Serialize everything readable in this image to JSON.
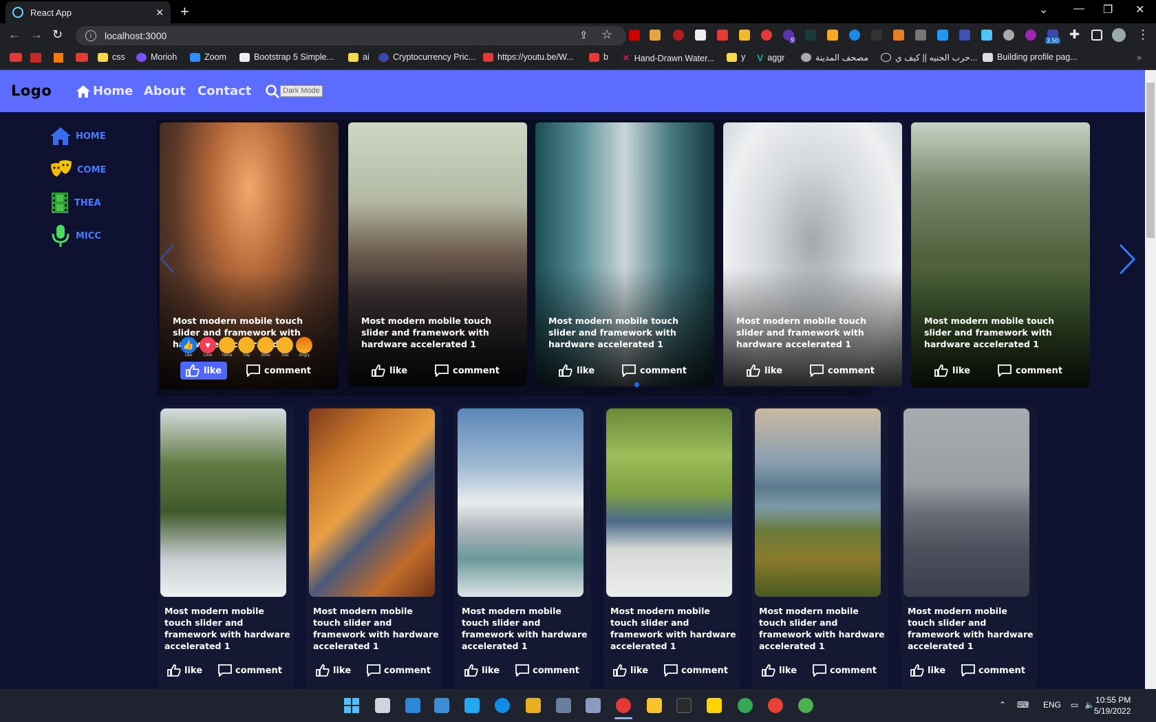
{
  "browser": {
    "tab_title": "React App",
    "new_tab": "+",
    "url": "localhost:3000",
    "bookmarks": [
      "css",
      "Morioh",
      "Zoom",
      "Bootstrap 5 Simple...",
      "ai",
      "Cryptocurrency Pric...",
      "https://youtu.be/W...",
      "b",
      "Hand-Drawn Water...",
      "y",
      "aggr",
      "مصحف المدينة",
      "حرب الجنيه || كيف ي...",
      "Building profile pag..."
    ],
    "ext_badges": [
      "9",
      "3.50"
    ]
  },
  "app": {
    "logo": "Logo",
    "nav": [
      "Home",
      "About",
      "Contact"
    ],
    "dark_mode": "Dark Mode",
    "sidebar": [
      "HOME",
      "COME",
      "THEA",
      "MICC"
    ],
    "slider": {
      "cards": [
        {
          "title": "Most modern mobile touch slider and framework with hardware accelerated 1",
          "like": "like",
          "comment": "comment"
        },
        {
          "title": "Most modern mobile touch slider and framework with hardware accelerated 1",
          "like": "like",
          "comment": "comment"
        },
        {
          "title": "Most modern mobile touch slider and framework with hardware accelerated 1",
          "like": "like",
          "comment": "comment"
        },
        {
          "title": "Most modern mobile touch slider and framework with hardware accelerated 1",
          "like": "like",
          "comment": "comment"
        },
        {
          "title": "Most modern mobile touch slider and framework with hardware accelerated 1",
          "like": "like",
          "comment": "comment"
        }
      ],
      "reactions": [
        "Like",
        "Love",
        "Haha",
        "Yay",
        "Wow",
        "Sad",
        "Angry"
      ]
    },
    "grid": {
      "cards": [
        {
          "title": "Most modern mobile touch slider and framework with hardware accelerated 1",
          "like": "like",
          "comment": "comment"
        },
        {
          "title": "Most modern mobile touch slider and framework with hardware accelerated 1",
          "like": "like",
          "comment": "comment"
        },
        {
          "title": "Most modern mobile touch slider and framework with hardware accelerated 1",
          "like": "like",
          "comment": "comment"
        },
        {
          "title": "Most modern mobile touch slider and framework with hardware accelerated 1",
          "like": "like",
          "comment": "comment"
        },
        {
          "title": "Most modern mobile touch slider and framework with hardware accelerated 1",
          "like": "like",
          "comment": "comment"
        },
        {
          "title": "Most modern mobile touch slider and framework with hardware accelerated 1",
          "like": "like",
          "comment": "comment"
        }
      ]
    }
  },
  "taskbar": {
    "lang": "ENG",
    "time": "10:55 PM",
    "date": "5/19/2022"
  },
  "colors": {
    "accent": "#5c6cff",
    "page_bg": "#0e1130",
    "sidebar_text": "#4b7bff"
  }
}
